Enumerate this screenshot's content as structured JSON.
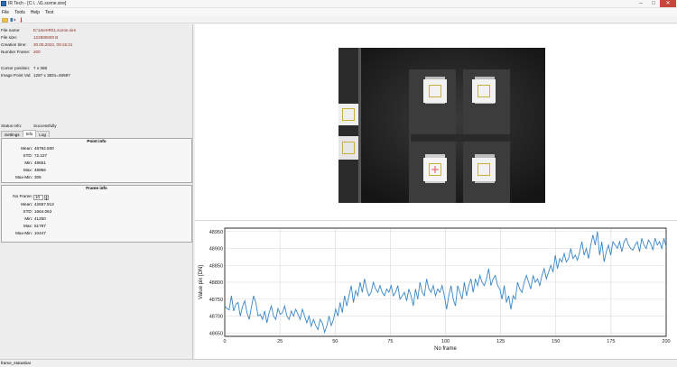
{
  "window": {
    "title": "IR Tech - [C:\\...\\t1.scene.sire]",
    "controls": [
      "minimize",
      "maximize",
      "close"
    ]
  },
  "menu": {
    "items": [
      "File",
      "Tools",
      "Help",
      "Test"
    ]
  },
  "toolbar": {
    "icons": [
      "open-folder-icon",
      "settings-icon",
      "temperature-probe-icon"
    ]
  },
  "file_info": {
    "file_name_label": "File name:",
    "file_name_value": "E:\\UserIR\\t1.scene.sire",
    "file_size_label": "File size:",
    "file_size_value": "122880000 B",
    "creation_time_label": "Creation time:",
    "creation_time_value": "30.05.2022, 09:15:21",
    "number_frame_label": "Number Frame:",
    "number_frame_value": "200"
  },
  "cursor": {
    "position_label": "Cursor position:",
    "position_value": "7 x 368",
    "image_point_label": "Image Point Val:",
    "image_point_value": "1287 x 3831=48697"
  },
  "status_info": {
    "label": "Status Info:",
    "value": "Successfully"
  },
  "tabs": [
    "Settings",
    "Info",
    "Log"
  ],
  "active_tab": "Info",
  "point_info": {
    "title": "Point info",
    "rows": [
      {
        "label": "Mean:",
        "value": "48792.500"
      },
      {
        "label": "STD:",
        "value": "72.227"
      },
      {
        "label": "Min:",
        "value": "48651"
      },
      {
        "label": "Max:",
        "value": "48956"
      },
      {
        "label": "Max-Min:",
        "value": "305"
      }
    ]
  },
  "frame_info": {
    "title": "Frame info",
    "no_frame_label": "No Frame:",
    "no_frame_value": "10",
    "rows": [
      {
        "label": "Mean:",
        "value": "42667.913"
      },
      {
        "label": "STD:",
        "value": "1664.063"
      },
      {
        "label": "Min:",
        "value": "41250"
      },
      {
        "label": "Max:",
        "value": "51787"
      },
      {
        "label": "Max-Min:",
        "value": "10447"
      }
    ]
  },
  "statusbar": {
    "text": "frame_statusbar"
  },
  "thermal": {
    "marker_color": "#c8b040",
    "crosshair_color": "#e03030"
  },
  "chart_data": {
    "type": "line",
    "xlabel": "No frame",
    "ylabel": "Value pix [DN]",
    "xlim": [
      0,
      200
    ],
    "ylim": [
      48640,
      48960
    ],
    "xticks": [
      0,
      25,
      50,
      75,
      100,
      125,
      150,
      175,
      200
    ],
    "yticks": [
      48650,
      48700,
      48750,
      48800,
      48850,
      48900,
      48950
    ],
    "grid": true,
    "line_color": "#3a87c8",
    "series": [
      {
        "values": [
          48731,
          48722,
          48718,
          48760,
          48715,
          48735,
          48740,
          48700,
          48728,
          48745,
          48710,
          48690,
          48725,
          48760,
          48740,
          48700,
          48705,
          48690,
          48715,
          48680,
          48710,
          48730,
          48700,
          48690,
          48722,
          48705,
          48710,
          48730,
          48700,
          48690,
          48715,
          48700,
          48720,
          48705,
          48690,
          48720,
          48700,
          48680,
          48700,
          48670,
          48690,
          48672,
          48660,
          48690,
          48680,
          48652,
          48670,
          48700,
          48672,
          48690,
          48720,
          48700,
          48740,
          48710,
          48760,
          48730,
          48760,
          48790,
          48740,
          48775,
          48760,
          48800,
          48770,
          48810,
          48780,
          48760,
          48770,
          48800,
          48780,
          48770,
          48790,
          48770,
          48760,
          48780,
          48770,
          48790,
          48760,
          48770,
          48790,
          48750,
          48760,
          48770,
          48745,
          48780,
          48760,
          48730,
          48780,
          48750,
          48800,
          48770,
          48760,
          48810,
          48780,
          48770,
          48790,
          48760,
          48780,
          48770,
          48790,
          48760,
          48720,
          48760,
          48790,
          48750,
          48730,
          48790,
          48770,
          48750,
          48800,
          48760,
          48790,
          48810,
          48770,
          48810,
          48790,
          48820,
          48800,
          48790,
          48810,
          48840,
          48790,
          48810,
          48820,
          48790,
          48780,
          48750,
          48790,
          48740,
          48760,
          48720,
          48760,
          48750,
          48800,
          48780,
          48770,
          48800,
          48820,
          48800,
          48780,
          48820,
          48800,
          48810,
          48790,
          48820,
          48840,
          48810,
          48830,
          48850,
          48830,
          48880,
          48840,
          48870,
          48860,
          48885,
          48860,
          48870,
          48900,
          48870,
          48880,
          48865,
          48890,
          48920,
          48880,
          48900,
          48870,
          48910,
          48940,
          48910,
          48950,
          48880,
          48920,
          48860,
          48890,
          48910,
          48880,
          48920,
          48910,
          48900,
          48920,
          48890,
          48920,
          48930,
          48910,
          48900,
          48895,
          48910,
          48920,
          48890,
          48930,
          48910,
          48900,
          48925,
          48915,
          48895,
          48930,
          48910,
          48920,
          48900,
          48930,
          48905
        ]
      }
    ]
  }
}
